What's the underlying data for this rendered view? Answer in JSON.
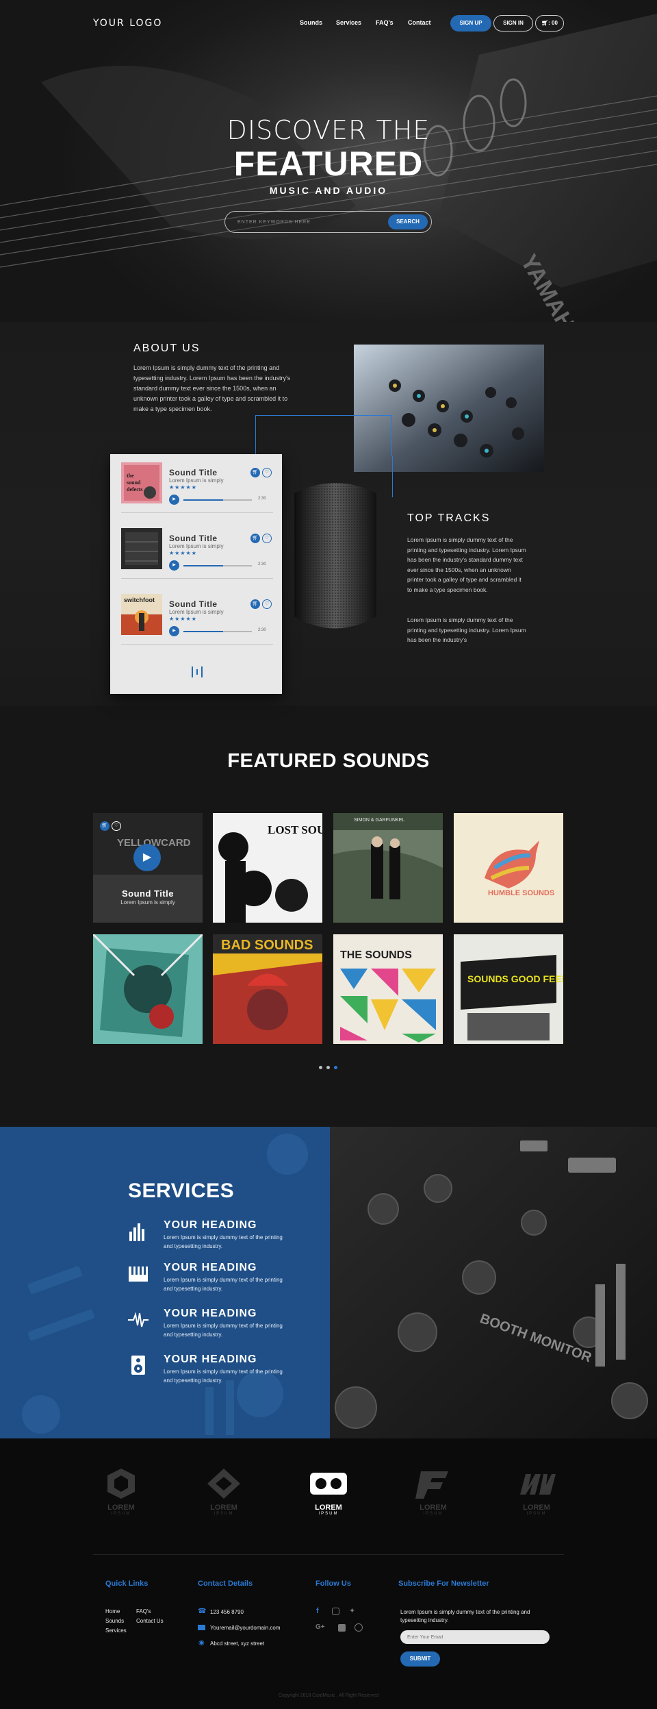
{
  "header": {
    "logo": "YOUR LOGO",
    "nav": [
      "Sounds",
      "Services",
      "FAQ's",
      "Contact"
    ],
    "signup": "SIGN UP",
    "signin": "SIGN IN",
    "cart": ": 00"
  },
  "hero": {
    "line1": "DISCOVER THE",
    "line2": "FEATURED",
    "line3": "MUSIC AND AUDIO",
    "search_placeholder": "ENTER KEYWORDS HERE",
    "search_button": "SEARCH"
  },
  "about": {
    "heading": "ABOUT US",
    "text": "Lorem Ipsum is simply dummy text of the printing and typesetting industry. Lorem Ipsum has been the industry's standard dummy text ever since the 1500s, when an unknown printer took a galley of type and scrambled it to make a type specimen book."
  },
  "tracks": [
    {
      "title": "Sound Title",
      "sub": "Lorem Ipsum is simply",
      "stars": "★★★★★",
      "time": "2:30",
      "progress": 0.58
    },
    {
      "title": "Sound Title",
      "sub": "Lorem Ipsum is simply",
      "stars": "★★★★★",
      "time": "2:30",
      "progress": 0.58
    },
    {
      "title": "Sound Title",
      "sub": "Lorem Ipsum is simply",
      "stars": "★★★★★",
      "time": "2:30",
      "progress": 0.58
    }
  ],
  "top_tracks": {
    "heading": "TOP TRACKS",
    "text1": "Lorem Ipsum is simply dummy text of the printing and typesetting industry. Lorem Ipsum has been the industry's standard dummy text ever since the 1500s, when an unknown printer took a galley of type and scrambled it to make a type specimen book.",
    "text2": "Lorem Ipsum is simply dummy text of the printing and typesetting industry. Lorem Ipsum has been the industry's"
  },
  "featured": {
    "heading": "FEATURED SOUNDS",
    "overlay_title": "Sound Title",
    "overlay_sub": "Lorem Ipsum is simply",
    "tiles": [
      {
        "text": "YELLOWCARD"
      },
      {
        "text": "LOST SOUNDS"
      },
      {
        "text": "SIMON & GARFUNKEL"
      },
      {
        "text": "HUMBLE SOUNDS"
      },
      {
        "text": ""
      },
      {
        "text": "BAD SOUNDS"
      },
      {
        "text": "THE SOUNDS"
      },
      {
        "text": "SOUNDS GOOD FEELS GOOD"
      }
    ]
  },
  "services": {
    "heading": "SERVICES",
    "items": [
      {
        "icon": "equalizer-icon",
        "title": "YOUR HEADING",
        "text": "Lorem Ipsum is simply dummy text of the printing and typesetting industry."
      },
      {
        "icon": "piano-icon",
        "title": "YOUR HEADING",
        "text": "Lorem Ipsum is simply dummy text of the printing and typesetting industry."
      },
      {
        "icon": "waveform-icon",
        "title": "YOUR HEADING",
        "text": "Lorem Ipsum is simply dummy text of the printing and typesetting industry."
      },
      {
        "icon": "speaker-icon",
        "title": "YOUR HEADING",
        "text": "Lorem Ipsum is simply dummy text of the printing and typesetting industry."
      }
    ]
  },
  "partners": [
    {
      "name": "LOREM",
      "sub": "IPSUM"
    },
    {
      "name": "LOREM",
      "sub": "IPSUM"
    },
    {
      "name": "LOREM",
      "sub": "IPSUM"
    },
    {
      "name": "LOREM",
      "sub": "IPSUM"
    },
    {
      "name": "LOREM",
      "sub": "IPSUM"
    }
  ],
  "footer": {
    "quick_links_heading": "Quick Links",
    "links_col1": [
      "Home",
      "Sounds",
      "Services"
    ],
    "links_col2": [
      "FAQ's",
      "Contact Us"
    ],
    "contact_heading": "Contact Details",
    "phone": "123 456 8790",
    "email": "Youremail@yourdomain.com",
    "address": "Abcd street, xyz street",
    "follow_heading": "Follow Us",
    "newsletter_heading": "Subscribe For Newsletter",
    "newsletter_text": "Lorem Ipsum is simply dummy text of the printing and typesetting industry.",
    "newsletter_placeholder": "Enter Your Email",
    "submit": "SUBMIT",
    "copyright": "Copyright 2018 CurdMusic . All Right Reserved"
  },
  "colors": {
    "accent": "#2469b3",
    "link_blue": "#2a7ad4",
    "services_blue": "#1f4f86"
  }
}
